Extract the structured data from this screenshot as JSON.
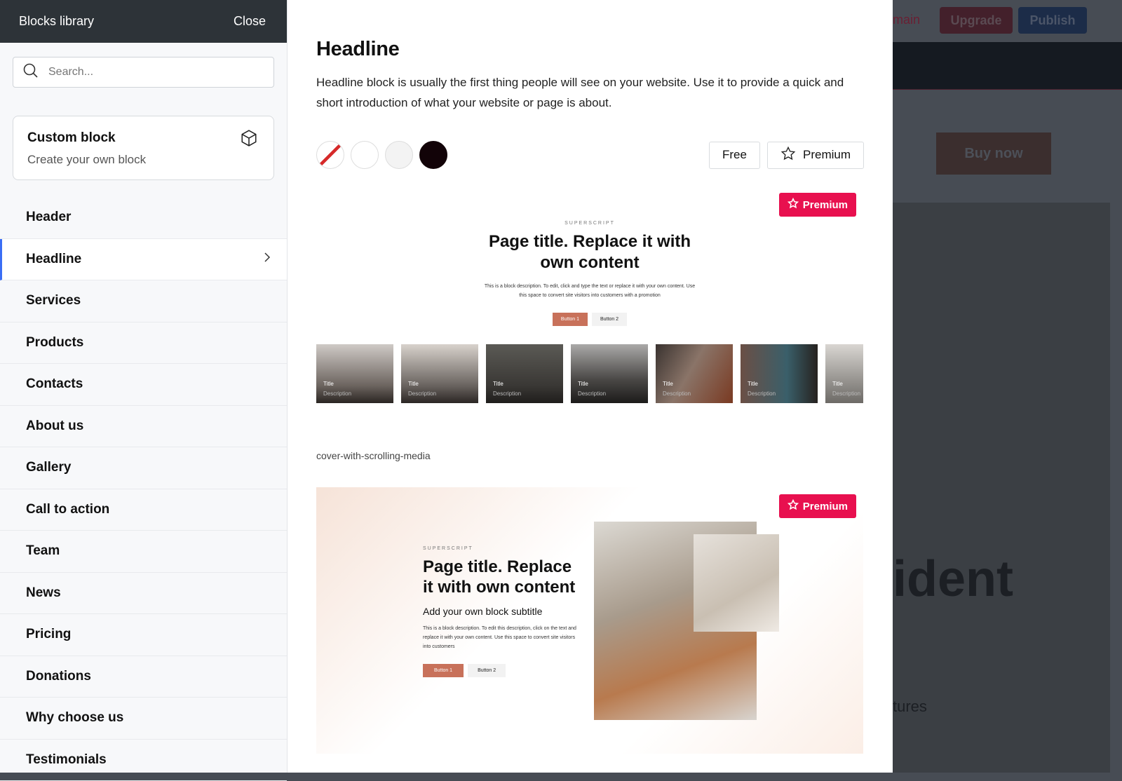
{
  "sidebar": {
    "title": "Blocks library",
    "close": "Close",
    "search_placeholder": "Search...",
    "custom": {
      "title": "Custom block",
      "subtitle": "Create your own block"
    },
    "items": [
      "Header",
      "Headline",
      "Services",
      "Products",
      "Contacts",
      "About us",
      "Gallery",
      "Call to action",
      "Team",
      "News",
      "Pricing",
      "Donations",
      "Why choose us",
      "Testimonials"
    ],
    "active": "Headline"
  },
  "main": {
    "title": "Headline",
    "description": "Headline block is usually the first thing people will see on your website. Use it to provide a quick and short introduction of what your website or page is about.",
    "swatches": [
      "none",
      "#ffffff",
      "#f3f3f3",
      "#120308"
    ],
    "filters": {
      "free": "Free",
      "premium": "Premium"
    },
    "preview1": {
      "badge": "Premium",
      "superscript": "SUPERSCRIPT",
      "title": "Page title. Replace it with own content",
      "description": "This is a block description. To edit, click and type the text or replace it with your own content. Use this space to convert site visitors into customers with a promotion",
      "button1": "Button 1",
      "button2": "Button 2",
      "thumb_title": "Title",
      "thumb_desc": "Description"
    },
    "preview1_name": "cover-with-scrolling-media",
    "preview2": {
      "badge": "Premium",
      "superscript": "SUPERSCRIPT",
      "title": "Page title. Replace it with own content",
      "subtitle": "Add your own block subtitle",
      "description": "This is a block description. To edit this description, click on the text and replace it with your own content. Use this space to convert site visitors into customers",
      "button1": "Button 1",
      "button2": "Button 2"
    }
  },
  "background": {
    "domain_link": "main",
    "upgrade": "Upgrade",
    "publish": "Publish",
    "buy_now": "Buy now",
    "hero_fragment": "ident",
    "features_fragment": "tures"
  },
  "colors": {
    "premium": "#e8104f",
    "accent": "#3b6ef5",
    "button1": "#c8715a"
  }
}
